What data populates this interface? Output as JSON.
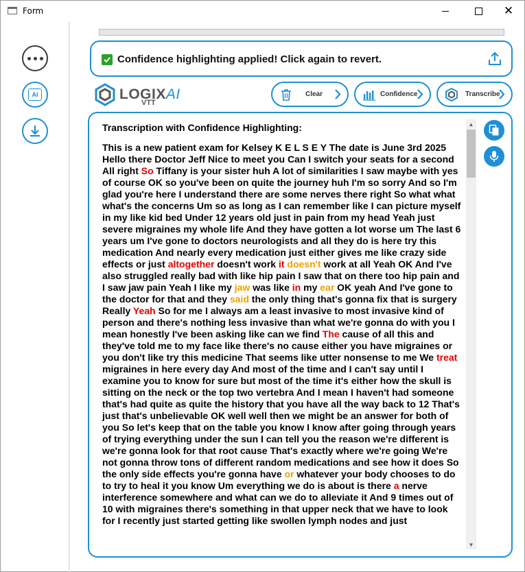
{
  "window": {
    "title": "Form"
  },
  "notice": {
    "text": "Confidence highlighting applied! Click again to revert."
  },
  "logo": {
    "main": "LOGIX",
    "accent": "AI",
    "sub": "VTT"
  },
  "toolbar": {
    "clear_label": "Clear",
    "confidence_label": "Confidence",
    "transcribe_label": "Transcribe"
  },
  "transcript": {
    "heading": "Transcription with Confidence Highlighting:",
    "segments": [
      {
        "text": "This is a new patient exam for Kelsey K E L S E Y The date is June 3rd 2025 Hello there Doctor Jeff Nice to meet you Can I switch your seats for a second All right ",
        "level": "normal"
      },
      {
        "text": "So",
        "level": "low"
      },
      {
        "text": " Tiffany is your sister huh A lot of similarities I saw maybe with yes of course OK so you've been on quite the journey huh I'm so sorry And so I'm glad you're here I understand there are some nerves there right So what what what's the concerns Um so as long as I can remember like I can picture myself in my like kid bed Under 12 years old just in pain from my head Yeah just severe migraines my whole life And they have gotten a lot worse um The last 6 years um I've gone to doctors neurologists and all they do is here try this medication And nearly every medication just either gives me like crazy side effects or just ",
        "level": "normal"
      },
      {
        "text": "altogether",
        "level": "low"
      },
      {
        "text": " doesn't work ",
        "level": "normal"
      },
      {
        "text": "it",
        "level": "low"
      },
      {
        "text": " ",
        "level": "normal"
      },
      {
        "text": "doesn't",
        "level": "medium"
      },
      {
        "text": " work at all Yeah OK And I've also struggled really bad with like hip pain I saw that on there too hip pain and I saw jaw pain Yeah I like my ",
        "level": "normal"
      },
      {
        "text": "jaw",
        "level": "medium"
      },
      {
        "text": " was like ",
        "level": "normal"
      },
      {
        "text": "in",
        "level": "low"
      },
      {
        "text": " my ",
        "level": "normal"
      },
      {
        "text": "ear",
        "level": "medium"
      },
      {
        "text": " OK yeah And I've gone to the doctor for that and they ",
        "level": "normal"
      },
      {
        "text": "said",
        "level": "medium"
      },
      {
        "text": " the only thing that's gonna fix that is surgery Really ",
        "level": "normal"
      },
      {
        "text": "Yeah",
        "level": "low"
      },
      {
        "text": " So for me I always am a least invasive to most invasive kind of person and there's nothing less invasive than what we're gonna do with you I mean honestly I've been asking like can we find ",
        "level": "normal"
      },
      {
        "text": "The",
        "level": "low"
      },
      {
        "text": " cause of all this and they've told me to my face like there's no cause either you have migraines or you don't like try this medicine That seems like utter nonsense to me We ",
        "level": "normal"
      },
      {
        "text": "treat",
        "level": "low"
      },
      {
        "text": " migraines in here every day And most of the time and I can't say until I examine you to know for sure but most of the time it's either how the skull is sitting on the neck or the top two vertebra And I mean I haven't had someone that's had quite as quite the history that you have all the way back to 12 That's just that's unbelievable OK well well then we might be an answer for both of you So let's keep that on the table you know I know after going through years of trying everything under the sun I can tell you the reason we're different is we're gonna look for that root cause That's exactly where we're going We're not gonna throw tons of different random medications and see how it does So the only side effects you're gonna have ",
        "level": "normal"
      },
      {
        "text": "or",
        "level": "medium"
      },
      {
        "text": " whatever your body chooses to do to try to heal it you know Um everything we do is about is there ",
        "level": "normal"
      },
      {
        "text": "a",
        "level": "low"
      },
      {
        "text": " nerve interference somewhere and what can we do to alleviate it And 9 times out of 10 with migraines there's something in that upper neck that we have to look for I recently just started getting like swollen lymph nodes and just",
        "level": "normal"
      }
    ]
  },
  "colors": {
    "accent": "#1f8fd6",
    "low_confidence": "#e00000",
    "medium_confidence": "#f0a000",
    "success": "#2aa22a"
  },
  "icons": {
    "more": "more-horizontal-icon",
    "ai": "ai-chip-icon",
    "download": "download-icon",
    "upload": "upload-icon",
    "clear": "trash-icon",
    "confidence": "bar-chart-icon",
    "transcribe": "logo-hex-icon",
    "copy": "copy-icon",
    "mic": "microphone-icon"
  }
}
